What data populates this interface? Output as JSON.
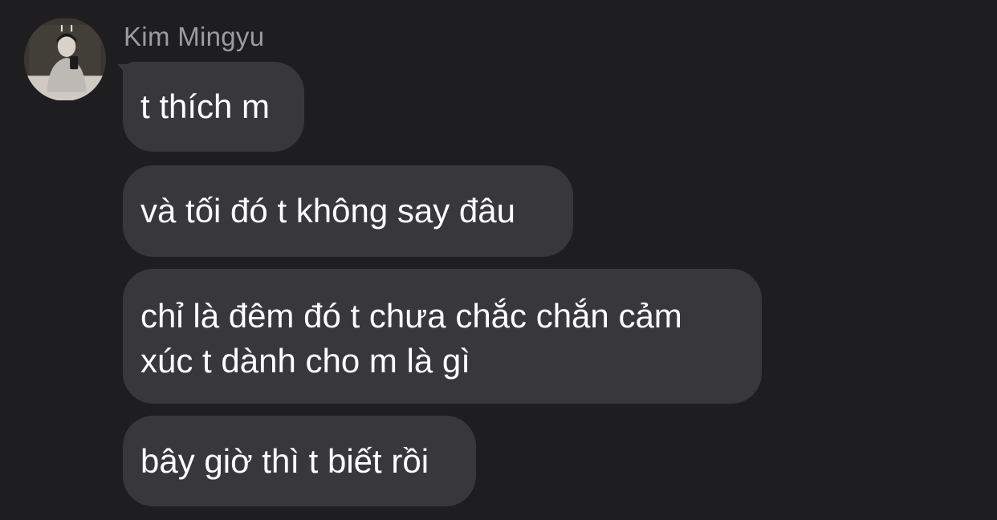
{
  "chat": {
    "sender": {
      "name": "Kim Mingyu",
      "avatar_icon": "profile-photo-mirror-selfie"
    },
    "messages": [
      {
        "text": "t thích m"
      },
      {
        "text": "và tối đó t không say đâu"
      },
      {
        "lines": [
          "chỉ là đêm đó t chưa chắc chắn cảm",
          "xúc t dành cho m là gì"
        ]
      },
      {
        "text": "bây giờ thì t biết rồi"
      }
    ]
  },
  "colors": {
    "background": "#1e1e20",
    "bubble": "#38383c",
    "message_text": "#ffffff",
    "sender_name": "#9b9ba0"
  }
}
